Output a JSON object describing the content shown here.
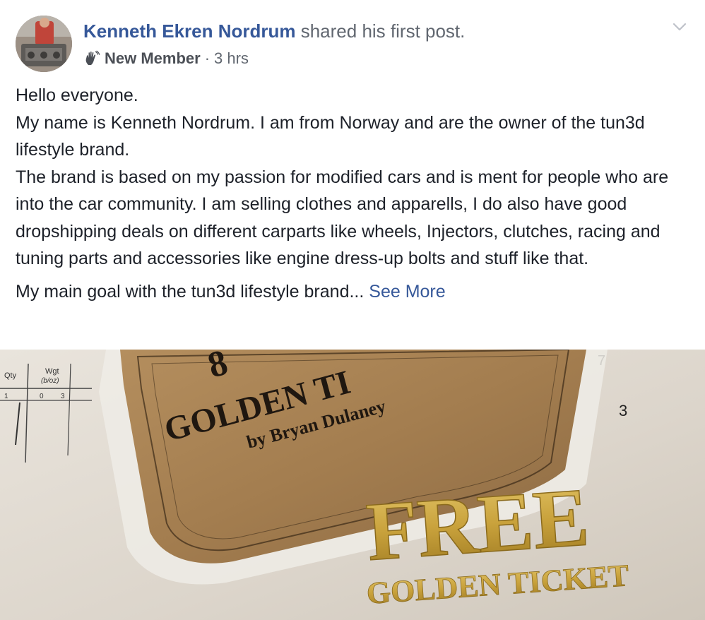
{
  "post": {
    "author_name": "Kenneth Ekren Nordrum",
    "action_text": " shared his first post.",
    "badge_icon": "waving-hand-icon",
    "badge_label": "New Member",
    "separator": "·",
    "time": "3 hrs",
    "paragraph_1": "Hello everyone.\nMy name is Kenneth Nordrum. I am from Norway and are the owner of the tun3d lifestyle brand.\nThe brand is based on my passion for modified cars and is ment for people who are into the car community. I am selling clothes and apparells, I do also have good dropshipping deals on different carparts like wheels, Injectors, clutches, racing and tuning parts and accessories like engine dress-up bolts and stuff like that.",
    "paragraph_2": "My main goal with the tun3d lifestyle brand...",
    "see_more": "See More"
  },
  "photo": {
    "card_line_1": "8",
    "card_line_2": "GOLDEN TI",
    "card_line_3": "by Bryan Dulaney",
    "free_text": "FREE",
    "ticket_text": "GOLDEN TICKET",
    "paper_col_1": "Qty",
    "paper_col_2": "Wgt",
    "paper_col_2b": "(b/oz)",
    "paper_val_1": "1",
    "paper_val_2": "0",
    "paper_val_3": "3",
    "paper_mark": "7",
    "paper_mark_2": "3"
  },
  "colors": {
    "link": "#365899",
    "text": "#1d2129",
    "meta": "#616770",
    "gold": "#c9a23c"
  }
}
